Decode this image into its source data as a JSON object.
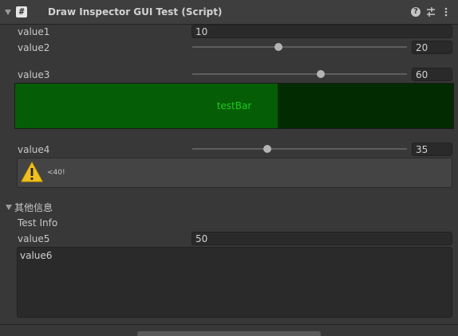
{
  "header": {
    "title": "Draw Inspector GUI Test (Script)",
    "script_icon_glyph": "#",
    "icons": [
      "fold-arrow-icon",
      "script-icon",
      "help-icon",
      "settings-sliders-icon",
      "more-menu-icon"
    ]
  },
  "fields": {
    "value1": {
      "label": "value1",
      "value": "10"
    },
    "value2": {
      "label": "value2",
      "value": "20",
      "slider_fraction": 0.4
    },
    "value3": {
      "label": "value3",
      "value": "60",
      "slider_fraction": 0.6
    },
    "value4": {
      "label": "value4",
      "value": "35",
      "slider_fraction": 0.35
    }
  },
  "progress_bar": {
    "label": "testBar",
    "fraction": 0.6,
    "fill_color": "#055e05",
    "track_color": "#022b02",
    "text_color": "#1ec81e"
  },
  "helpbox": {
    "icon": "warning-icon",
    "message": "<40!"
  },
  "foldout": {
    "label": "其他信息",
    "expanded": true
  },
  "info": {
    "test_info": "Test Info",
    "value5": {
      "label": "value5",
      "value": "50"
    },
    "value6": {
      "label": "value6"
    }
  }
}
